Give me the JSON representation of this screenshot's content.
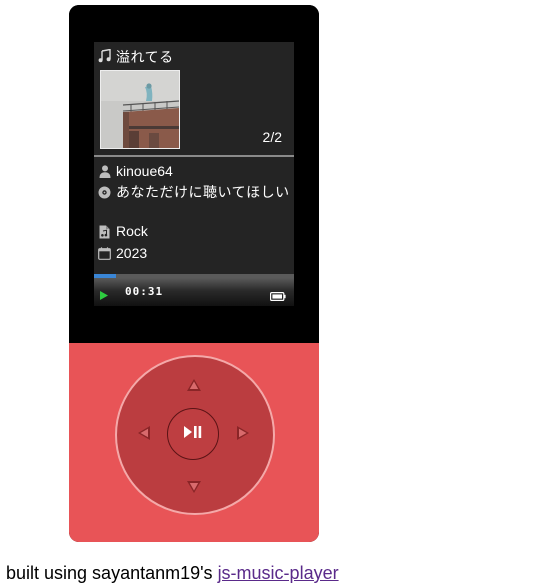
{
  "track": {
    "title": "溢れてる",
    "artist": "kinoue64",
    "album": "あなただけに聴いてほしい",
    "genre": "Rock",
    "year": "2023",
    "counter": "2/2"
  },
  "playback": {
    "elapsed": "00:31",
    "progress_fraction": 0.11,
    "state": "playing"
  },
  "icons": {
    "title": "music-note-icon",
    "artist": "person-icon",
    "album": "disc-icon",
    "genre": "audio-file-icon",
    "year": "calendar-icon",
    "play": "play-icon",
    "battery": "battery-icon",
    "wheel_up": "triangle-up-icon",
    "wheel_down": "triangle-down-icon",
    "wheel_left": "triangle-left-icon",
    "wheel_right": "triangle-right-icon",
    "wheel_center": "play-pause-icon"
  },
  "colors": {
    "body_bottom": "#e85457",
    "wheel": "#bb3d40",
    "screen": "#242424",
    "progress": "#3a86d6",
    "play_indicator": "#2ecc40"
  },
  "footer": {
    "prefix": "built using sayantanm19's ",
    "link_text": "js-music-player"
  }
}
